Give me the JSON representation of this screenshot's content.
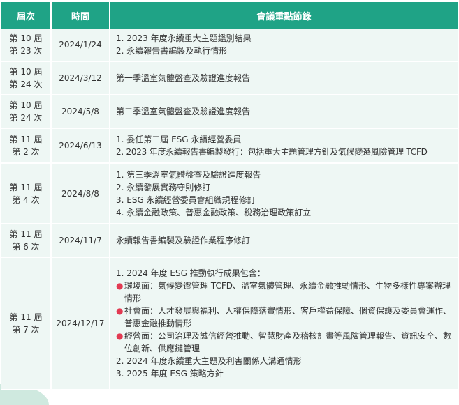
{
  "header": {
    "session": "屆次",
    "date": "時間",
    "notes": "會議重點節錄"
  },
  "rows": [
    {
      "session_a": "第 10 屆",
      "session_b": "第 23 次",
      "date": "2024/1/24",
      "notes": [
        "1. 2023 年度永續重大主題鑑別結果",
        "2. 永續報告書編製及執行情形"
      ]
    },
    {
      "session_a": "第 10 屆",
      "session_b": "第 24 次",
      "date": "2024/3/12",
      "notes": [
        "第一季溫室氣體盤查及驗證進度報告"
      ]
    },
    {
      "session_a": "第 10 屆",
      "session_b": "第 24 次",
      "date": "2024/5/8",
      "notes": [
        "第二季溫室氣體盤查及驗證進度報告"
      ]
    },
    {
      "session_a": "第 11 屆",
      "session_b": "第 2 次",
      "date": "2024/6/13",
      "notes": [
        "1.  委任第二屆 ESG 永續經營委員",
        "2. 2023 年度永續報告書編製發行：包括重大主題管理方針及氣候變遷風險管理 TCFD"
      ]
    },
    {
      "session_a": "第 11 屆",
      "session_b": "第 4 次",
      "date": "2024/8/8",
      "notes": [
        "1. 第三季溫室氣體盤查及驗證進度報告",
        "2. 永續發展實務守則修訂",
        "3. ESG 永續經營委員會組織規程修訂",
        "4. 永續金融政策、普惠金融政策、稅務治理政策訂立"
      ]
    },
    {
      "session_a": "第 11 屆",
      "session_b": "第 6 次",
      "date": "2024/11/7",
      "notes": [
        "永續報告書編製及驗證作業程序修訂"
      ]
    },
    {
      "session_a": "第 11 屆",
      "session_b": "第 7 次",
      "date": "2024/12/17",
      "intro": "1. 2024 年度 ESG 推動執行成果包含：",
      "bullets": [
        "環境面：氣候變遷管理 TCFD、溫室氣體管理、永續金融推動情形、生物多樣性專案辦理情形",
        "社會面：人才發展與福利、人權保障落實情形、客戶權益保障、個資保護及委員會運作、普惠金融推動情形",
        "經營面：公司治理及誠信經營推動、智慧財產及稽核計畫等風險管理報告、資訊安全、數位創新、供應鏈管理"
      ],
      "tail": [
        "2. 2024 年度永續重大主題及利害關係人溝通情形",
        "3. 2025 年度 ESG 策略方針"
      ]
    }
  ],
  "colors": {
    "header_bg": "#1fa386",
    "row_bg": "#eef7f4",
    "bullet": "#e23a52"
  }
}
